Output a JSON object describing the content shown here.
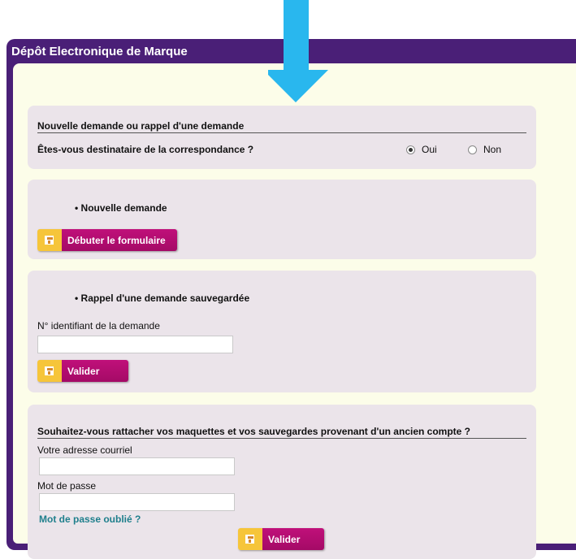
{
  "app": {
    "title": "Dépôt Electronique de Marque"
  },
  "correspondence": {
    "heading": "Nouvelle demande ou rappel d'une demande",
    "question": "Êtes-vous destinataire de la correspondance ?",
    "options": [
      {
        "label": "Oui",
        "selected": true
      },
      {
        "label": "Non",
        "selected": false
      }
    ]
  },
  "new_request": {
    "bullet": "• Nouvelle demande",
    "button_label": "Débuter le formulaire"
  },
  "recall": {
    "bullet": "• Rappel d'une demande sauvegardée",
    "field_label": "N° identifiant de la demande",
    "field_value": "",
    "button_label": "Valider"
  },
  "link_account": {
    "heading": "Souhaitez-vous rattacher vos maquettes et vos sauvegardes provenant d'un ancien compte ?",
    "email_label": "Votre adresse courriel",
    "email_value": "",
    "password_label": "Mot de passe",
    "password_value": "",
    "forgot_link": "Mot de passe oublié ?",
    "button_label": "Valider"
  },
  "colors": {
    "frame": "#4a1f77",
    "background": "#fcfde9",
    "panel": "#ebe4ea",
    "button": "#b10d6f",
    "button_icon": "#f6c53a",
    "link": "#1f7f8c",
    "arrow": "#29b7ee"
  },
  "icons": {
    "button_icon": "form-icon",
    "overlay": "down-arrow-icon"
  }
}
